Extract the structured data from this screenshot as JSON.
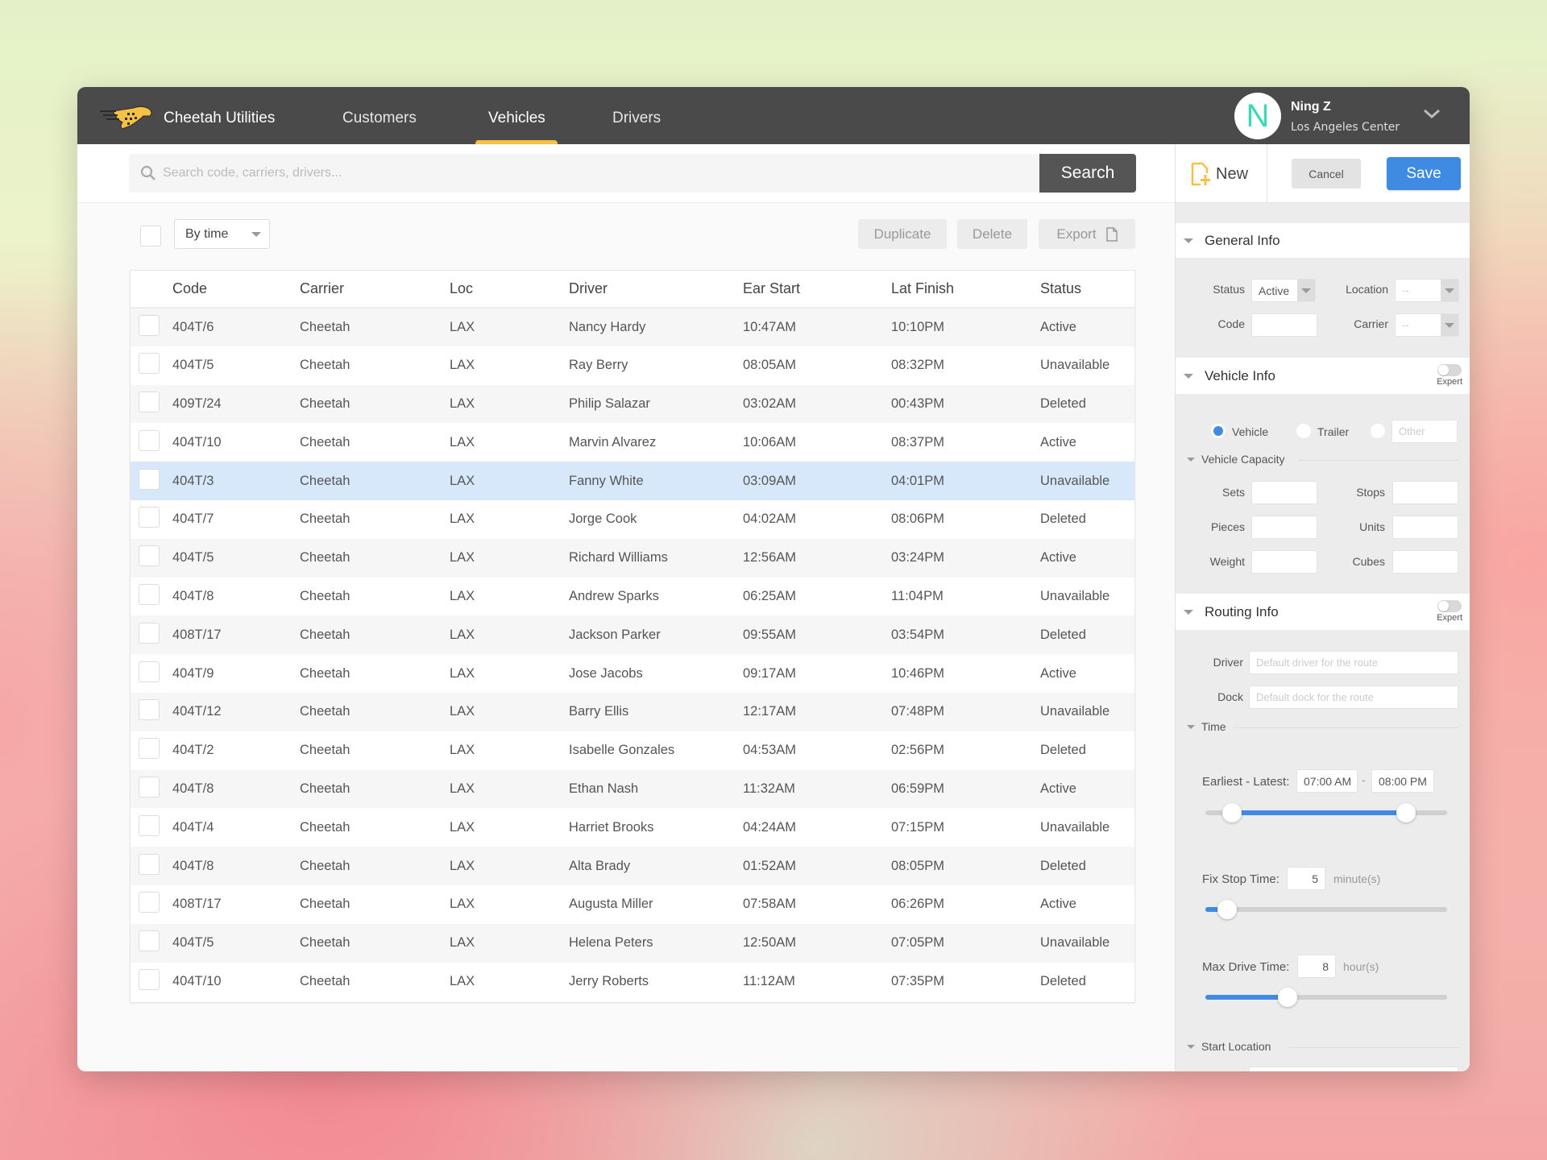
{
  "app": {
    "brand": "Cheetah Utilities",
    "nav": [
      {
        "label": "Customers",
        "active": false
      },
      {
        "label": "Vehicles",
        "active": true
      },
      {
        "label": "Drivers",
        "active": false
      }
    ],
    "user": {
      "initial": "N",
      "name": "Ning Z",
      "location": "Los Angeles Center"
    },
    "colors": {
      "accent": "#f5c144",
      "primary": "#3f8ae2",
      "topbar": "#4a4a4a",
      "avatar": "#3dd9b4",
      "selected_row": "#d8e8fb"
    }
  },
  "search": {
    "placeholder": "Search code, carriers, drivers...",
    "value": "",
    "button_label": "Search"
  },
  "toolbar": {
    "sort_select": "By time",
    "duplicate_label": "Duplicate",
    "delete_label": "Delete",
    "export_label": "Export"
  },
  "table": {
    "columns": [
      "Code",
      "Carrier",
      "Loc",
      "Driver",
      "Ear Start",
      "Lat Finish",
      "Status"
    ],
    "selected_row_index": 4,
    "rows": [
      [
        "404T/6",
        "Cheetah",
        "LAX",
        "Nancy Hardy",
        "10:47AM",
        "10:10PM",
        "Active"
      ],
      [
        "404T/5",
        "Cheetah",
        "LAX",
        "Ray Berry",
        "08:05AM",
        "08:32PM",
        "Unavailable"
      ],
      [
        "409T/24",
        "Cheetah",
        "LAX",
        "Philip Salazar",
        "03:02AM",
        "00:43PM",
        "Deleted"
      ],
      [
        "404T/10",
        "Cheetah",
        "LAX",
        "Marvin Alvarez",
        "10:06AM",
        "08:37PM",
        "Active"
      ],
      [
        "404T/3",
        "Cheetah",
        "LAX",
        "Fanny White",
        "03:09AM",
        "04:01PM",
        "Unavailable"
      ],
      [
        "404T/7",
        "Cheetah",
        "LAX",
        "Jorge Cook",
        "04:02AM",
        "08:06PM",
        "Deleted"
      ],
      [
        "404T/5",
        "Cheetah",
        "LAX",
        "Richard Williams",
        "12:56AM",
        "03:24PM",
        "Active"
      ],
      [
        "404T/8",
        "Cheetah",
        "LAX",
        "Andrew Sparks",
        "06:25AM",
        "11:04PM",
        "Unavailable"
      ],
      [
        "408T/17",
        "Cheetah",
        "LAX",
        "Jackson Parker",
        "09:55AM",
        "03:54PM",
        "Deleted"
      ],
      [
        "404T/9",
        "Cheetah",
        "LAX",
        "Jose Jacobs",
        "09:17AM",
        "10:46PM",
        "Active"
      ],
      [
        "404T/12",
        "Cheetah",
        "LAX",
        "Barry Ellis",
        "12:17AM",
        "07:48PM",
        "Unavailable"
      ],
      [
        "404T/2",
        "Cheetah",
        "LAX",
        "Isabelle Gonzales",
        "04:53AM",
        "02:56PM",
        "Deleted"
      ],
      [
        "404T/8",
        "Cheetah",
        "LAX",
        "Ethan Nash",
        "11:32AM",
        "06:59PM",
        "Active"
      ],
      [
        "404T/4",
        "Cheetah",
        "LAX",
        "Harriet Brooks",
        "04:24AM",
        "07:15PM",
        "Unavailable"
      ],
      [
        "404T/8",
        "Cheetah",
        "LAX",
        "Alta Brady",
        "01:52AM",
        "08:05PM",
        "Deleted"
      ],
      [
        "408T/17",
        "Cheetah",
        "LAX",
        "Augusta Miller",
        "07:58AM",
        "06:26PM",
        "Active"
      ],
      [
        "404T/5",
        "Cheetah",
        "LAX",
        "Helena Peters",
        "12:50AM",
        "07:05PM",
        "Unavailable"
      ],
      [
        "404T/10",
        "Cheetah",
        "LAX",
        "Jerry Roberts",
        "11:12AM",
        "07:35PM",
        "Deleted"
      ]
    ]
  },
  "panel": {
    "new_label": "New",
    "cancel_label": "Cancel",
    "save_label": "Save",
    "general_info": {
      "title": "General Info",
      "status_label": "Status",
      "status_value": "Active",
      "location_label": "Location",
      "location_value": "--",
      "code_label": "Code",
      "code_value": "",
      "carrier_label": "Carrier",
      "carrier_value": "--"
    },
    "vehicle_info": {
      "title": "Vehicle Info",
      "expert_label": "Expert",
      "expert_on": false,
      "types": [
        {
          "label": "Vehicle",
          "selected": true
        },
        {
          "label": "Trailer",
          "selected": false
        },
        {
          "label": "",
          "selected": false
        }
      ],
      "other_placeholder": "Other",
      "capacity_title": "Vehicle Capacity",
      "capacity_fields": [
        "Sets",
        "Stops",
        "Pieces",
        "Units",
        "Weight",
        "Cubes"
      ]
    },
    "routing_info": {
      "title": "Routing Info",
      "expert_label": "Expert",
      "expert_on": false,
      "driver_label": "Driver",
      "driver_placeholder": "Default driver for the route",
      "dock_label": "Dock",
      "dock_placeholder": "Default dock for the route",
      "time_title": "Time",
      "earliest_latest_label": "Earliest - Latest:",
      "earliest": "07:00 AM",
      "separator": "-",
      "latest": "08:00 PM",
      "time_range_fraction": [
        0.11,
        0.83
      ],
      "fix_stop_label": "Fix Stop Time:",
      "fix_stop_value": "5",
      "fix_stop_unit": "minute(s)",
      "fix_stop_fraction": 0.09,
      "max_drive_label": "Max Drive Time:",
      "max_drive_value": "8",
      "max_drive_unit": "hour(s)",
      "max_drive_fraction": 0.34,
      "start_location_title": "Start Location"
    }
  }
}
